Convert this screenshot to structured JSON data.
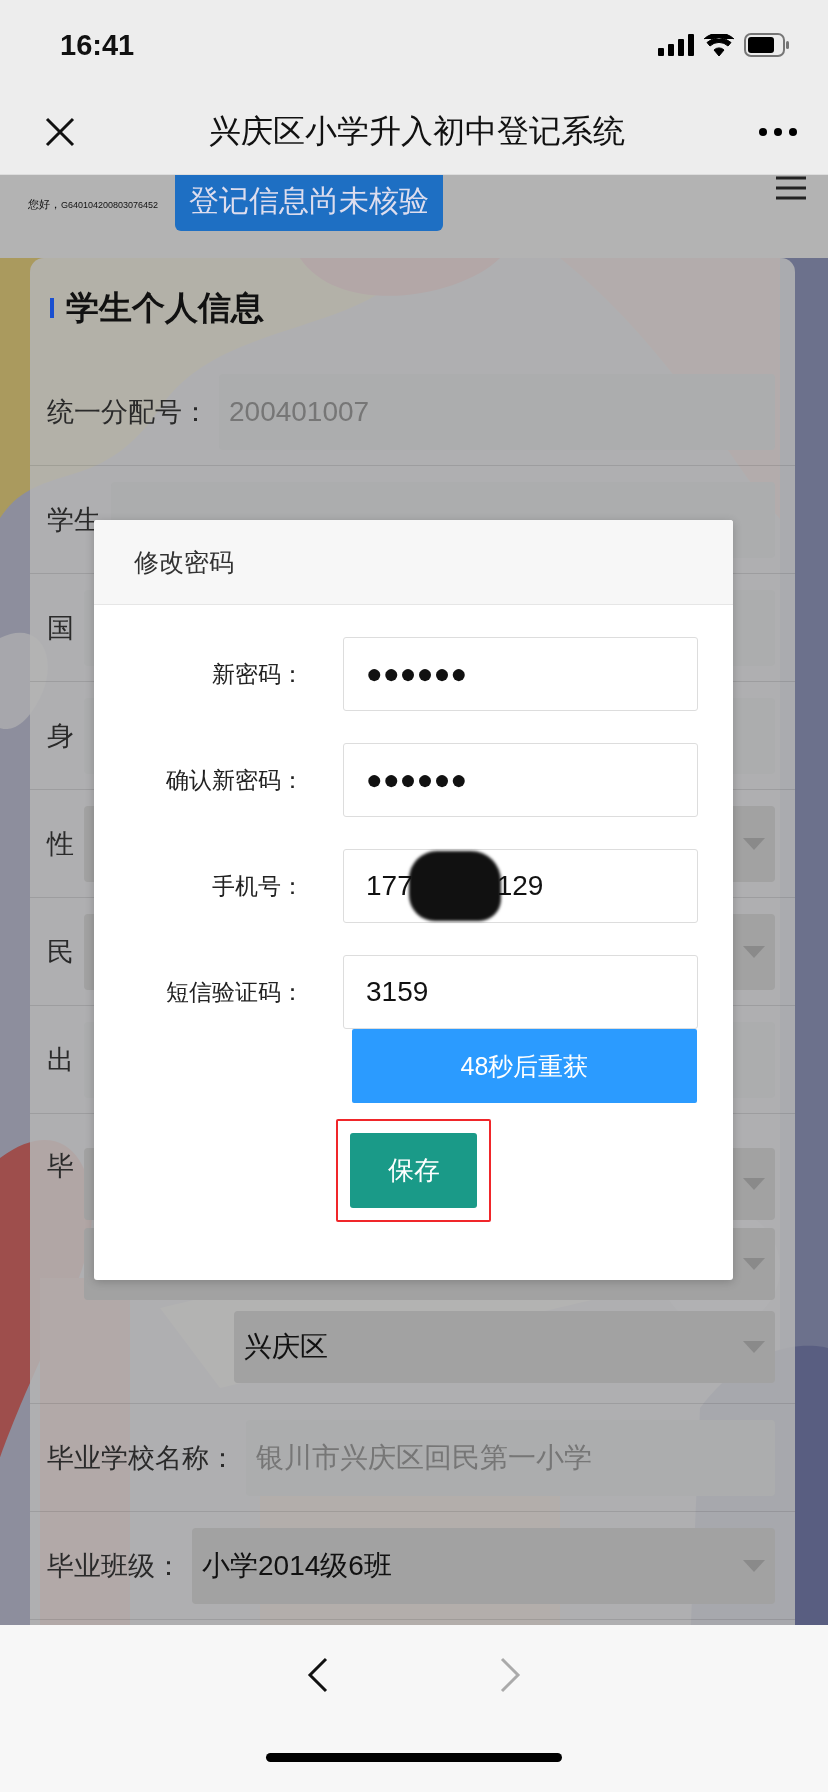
{
  "status_bar": {
    "time": "16:41"
  },
  "nav": {
    "title": "兴庆区小学升入初中登记系统"
  },
  "header": {
    "greeting": "您好，",
    "account": "G640104200803076452",
    "badge": "登记信息尚未核验"
  },
  "form": {
    "title": "学生个人信息",
    "rows": [
      {
        "kind": "text",
        "label": "统一分配号：",
        "value": "200401007"
      },
      {
        "kind": "text",
        "label": "学生"
      },
      {
        "kind": "text",
        "label": "国"
      },
      {
        "kind": "text",
        "label": "身"
      },
      {
        "kind": "select",
        "label": "性"
      },
      {
        "kind": "select",
        "label": "民"
      },
      {
        "kind": "text",
        "label": "出"
      },
      {
        "kind": "multi",
        "label": "毕",
        "selects": [
          {
            "kind": "select"
          },
          {
            "kind": "select"
          },
          {
            "kind": "select",
            "value": "兴庆区"
          }
        ]
      },
      {
        "kind": "text",
        "label": "毕业学校名称：",
        "value": "银川市兴庆区回民第一小学"
      },
      {
        "kind": "select",
        "label": "毕业班级：",
        "value": "小学2014级6班"
      }
    ]
  },
  "dialog": {
    "title": "修改密码",
    "fields": [
      {
        "kind": "plain",
        "label": "新密码：",
        "value": "●●●●●●"
      },
      {
        "kind": "plain",
        "label": "确认新密码：",
        "value": "●●●●●●"
      },
      {
        "kind": "redacted",
        "label": "手机号：",
        "shown_start": "177",
        "shown_end": "129"
      },
      {
        "kind": "plain",
        "label": "短信验证码：",
        "value": "3159"
      }
    ],
    "resend_button": "48秒后重获",
    "save_button": "保存",
    "save_highlighted": true
  },
  "bottom_bar": {
    "back_enabled": true,
    "forward_enabled": false
  }
}
